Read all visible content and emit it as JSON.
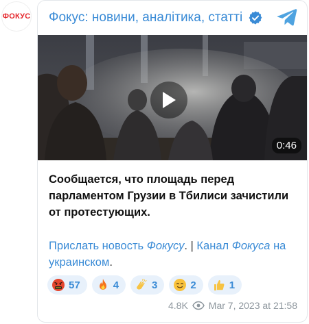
{
  "avatar": {
    "text": "ФОКУС"
  },
  "channel": {
    "title": "Фокус: новини, аналітика, статті"
  },
  "video": {
    "duration": "0:46"
  },
  "message": {
    "text": "Сообщается, что площадь перед парламентом Грузии в Тбилиси зачистили от протестующих."
  },
  "links": {
    "part1": "Прислать новость ",
    "part2": "Фокусу",
    "part3": ". ",
    "separator": "|",
    "part4": " Канал ",
    "part5": "Фокуса",
    "part6": " на украинском",
    "part7": "."
  },
  "reactions": [
    {
      "emoji": "cursing-face-icon",
      "count": "57"
    },
    {
      "emoji": "fire-icon",
      "count": "4"
    },
    {
      "emoji": "clapping-hands-icon",
      "count": "3"
    },
    {
      "emoji": "smiling-face-with-tear-icon",
      "count": "2"
    },
    {
      "emoji": "thumbs-up-icon",
      "count": "1"
    }
  ],
  "footer": {
    "views": "4.8K",
    "date": "Mar 7, 2023 at 21:58"
  },
  "colors": {
    "accent": "#3a8bd6",
    "brand_red": "#e4262b",
    "verified": "#3a8bd6"
  }
}
